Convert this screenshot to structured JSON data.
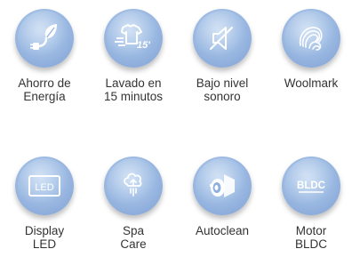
{
  "features": [
    {
      "label": "Ahorro de\nEnergía",
      "icon": "leaf-plug-icon"
    },
    {
      "label": "Lavado en\n15 minutos",
      "icon": "shirt-15-icon",
      "badge_text": "15'"
    },
    {
      "label": "Bajo nivel\nsonoro",
      "icon": "muted-speaker-icon"
    },
    {
      "label": "Woolmark",
      "icon": "woolmark-icon"
    },
    {
      "label": "Display\nLED",
      "icon": "led-display-icon",
      "badge_text": "LED"
    },
    {
      "label": "Spa\nCare",
      "icon": "spa-care-icon"
    },
    {
      "label": "Autoclean",
      "icon": "autoclean-icon"
    },
    {
      "label": "Motor\nBLDC",
      "icon": "bldc-motor-icon",
      "badge_text": "BLDC"
    }
  ],
  "colors": {
    "badge": "#9dbbe3",
    "icon": "#ffffff",
    "label": "#333333"
  }
}
